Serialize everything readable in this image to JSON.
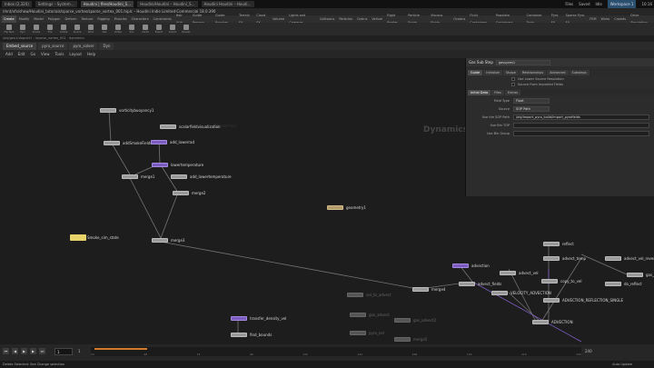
{
  "systabs": [
    "Inbox (2,324)",
    "Settings – System…",
    "Houdini | files/Houdini_S…",
    "Houdini/Houdini – Houdini_S…",
    "Houdini Houdini – Houdi…"
  ],
  "sysright": {
    "files": "Files",
    "saved": "Saved",
    "idle": "Idle",
    "workspace": "Workspace 1",
    "time": "10:16"
  },
  "title": "/mnt/vfx/show/Houdini_tutorials/sparse_vortex/sparse_vortex_001.hiplc – Houdini Indie Limited-Commercial 18.0.390",
  "shelftabs": [
    "Create",
    "Modify",
    "Model",
    "Polygon",
    "Deform",
    "Texture",
    "Rigging",
    "Muscles",
    "Characters",
    "Constraints",
    "Hair Utils",
    "Guide Process",
    "Guide Brushes",
    "Terrain FX",
    "Cloud FX",
    "Volume",
    "Lights and Cameras",
    "Collisions",
    "Particles",
    "Grains",
    "Vellum",
    "Rigid Bodies",
    "Particle Fluids",
    "Viscous Fluids",
    "Oceans",
    "Fluid Containers",
    "Populate Containers",
    "Container Tools",
    "Pyro FX",
    "Sparse Pyro FX",
    "FEM",
    "Wires",
    "Crowds",
    "Drive Simulation"
  ],
  "tools": [
    "Flip Tank",
    "Pyro",
    "Smoke",
    "Fire",
    "Collide",
    "Source",
    "Wind",
    "Gas",
    "Vortex",
    "Sim",
    "Cache",
    "Export",
    "Import",
    "Render"
  ],
  "path": "/obj/geo1/dopnet1 · /sparse_vortex_001 · dynamics",
  "paneltabs": [
    "Embed_source",
    "pyro_source",
    "pyro_solver",
    "Dyn"
  ],
  "menus": [
    "Add",
    "Edit",
    "Go",
    "View",
    "Tools",
    "Layout",
    "Help"
  ],
  "network": {
    "context": "Dynamics",
    "faint": "Dynamics"
  },
  "nodes": {
    "n1": "vorticitybuoyancy1",
    "n2": "scalarfieldvisualization",
    "n3": "addSmokeFields",
    "n4": "add_lowerrad",
    "n5": "lowertemperature",
    "n6": "add_lowertemperature",
    "n7": "merge1",
    "n8": "merge2",
    "n9": "merge3",
    "n10": "geometry1",
    "n11": "advection",
    "n12": "advect_vel",
    "n13": "advect_fields",
    "n14": "VELOCITY_ADVECTION",
    "n15": "copy_to_vel",
    "n16": "ADVECTION_REFLECTION_SINGLE",
    "n17": "advect_temp",
    "n18": "advect_vel_reverse",
    "n19": "reflect",
    "n20": "do_reflect",
    "n21": "ADVECTION",
    "n22": "transfer_density_vel",
    "n23": "find_bounds",
    "n24": "merge4",
    "n25": "vel_to_advect",
    "n26": "gas_advect",
    "n27": "gas_advect2",
    "n28": "pyro_vel",
    "n29": "merge5",
    "n30": "gas_calc"
  },
  "sticky": "Smoke_sim_state",
  "params": {
    "type": "Gas Sub Step",
    "name": "gasupres1",
    "tabs": [
      "Guide",
      "Initialize",
      "Shape",
      "Relationships",
      "Advanced",
      "Substeps"
    ],
    "chk1": "Use Lower Source Resolution",
    "chk2": "Source From Imported Fields",
    "tabs2": [
      "Initial Data",
      "Files",
      "Extras"
    ],
    "rows": [
      {
        "label": "Field Type",
        "value": "Float"
      },
      {
        "label": "Source",
        "value": "SOP Path"
      },
      {
        "label": "Use the SOP Path",
        "value": "/obj/import_pyro_build/import_pyrofields"
      },
      {
        "label": "Use Bln TOP",
        "value": ""
      },
      {
        "label": "Use Bln Group",
        "value": ""
      }
    ]
  },
  "timeline": {
    "frame": "1",
    "start": "1",
    "end": "240",
    "ticks": [
      "24",
      "48",
      "72",
      "96",
      "120",
      "144",
      "168",
      "192",
      "216",
      "240"
    ]
  },
  "status": "Delete Selected: See Change selection",
  "autoupdate": "Auto Update"
}
